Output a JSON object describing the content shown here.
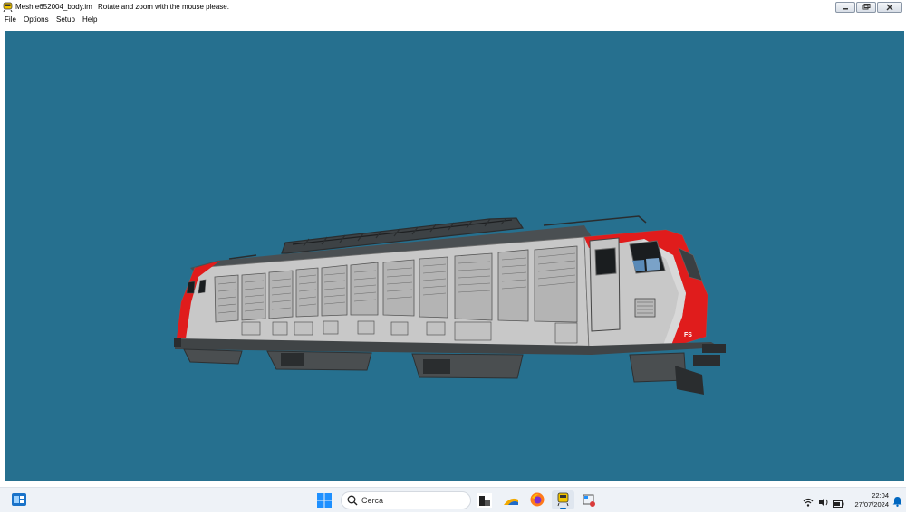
{
  "window": {
    "file_name": "Mesh e652004_body.im",
    "message": "Rotate and zoom with the mouse please."
  },
  "menu": [
    "File",
    "Options",
    "Setup",
    "Help"
  ],
  "viewport": {
    "background": "#26708f"
  },
  "model": {
    "colors": {
      "body": "#c8c8c8",
      "red": "#e01c1c",
      "roof": "#4a4f52",
      "chassis": "#404446"
    }
  },
  "taskbar": {
    "search_placeholder": "Cerca",
    "clock": {
      "time": "22:04",
      "date": "27/07/2024"
    },
    "icons": [
      "widgets-icon",
      "start-icon",
      "search-icon",
      "file-explorer-icon",
      "weather-icon",
      "firefox-icon",
      "train-app-icon",
      "snipping-tool-icon"
    ],
    "tray": [
      "wifi-icon",
      "volume-icon",
      "battery-icon",
      "notification-bell-icon"
    ]
  }
}
